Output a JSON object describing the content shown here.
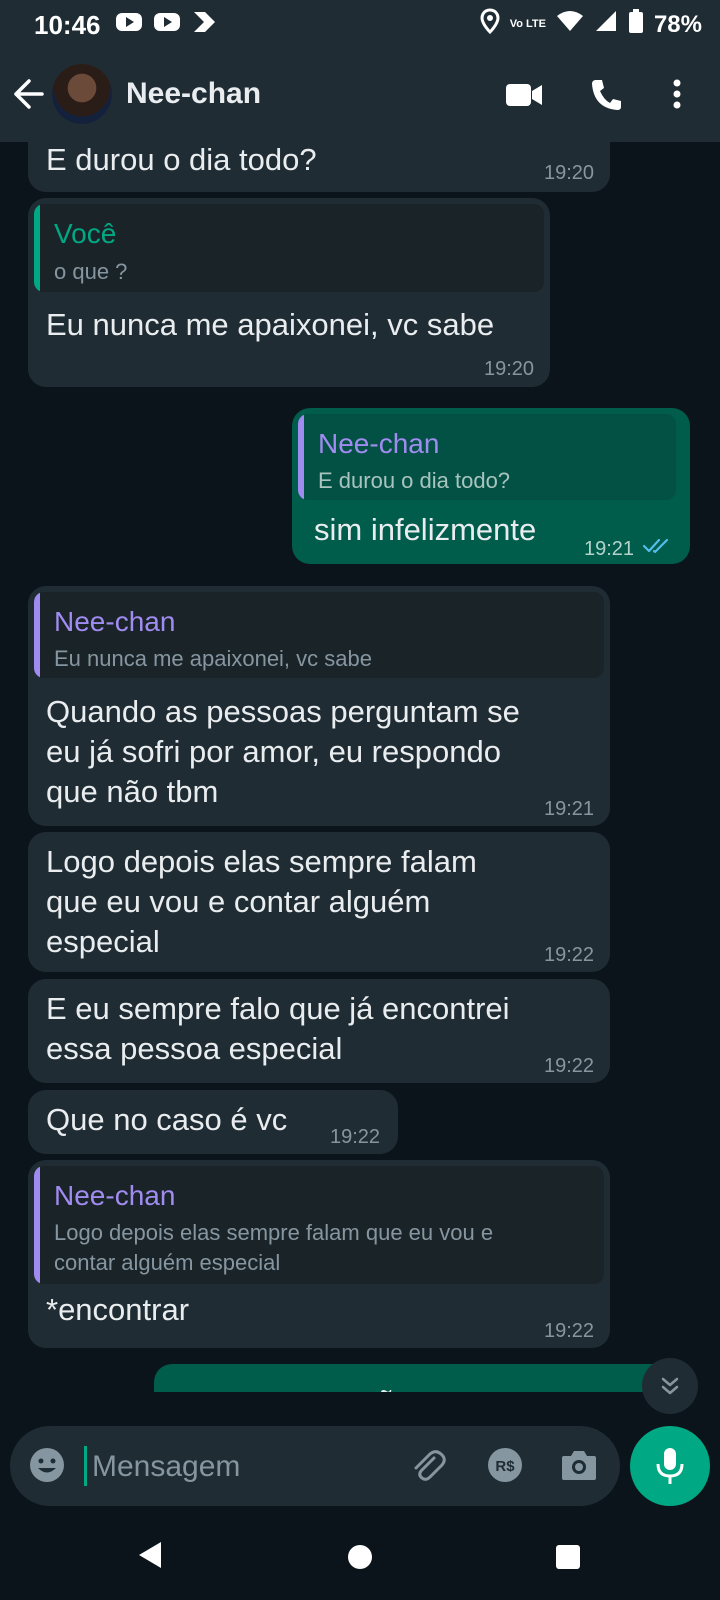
{
  "status_bar": {
    "time": "10:46",
    "network": "Vo LTE",
    "battery": "78%"
  },
  "header": {
    "contact_name": "Nee-chan"
  },
  "colors": {
    "outgoing": "#005c4b",
    "incoming": "#202c33",
    "accent": "#00a884",
    "quote_self": "#00a884",
    "quote_contact": "#a08cf0"
  },
  "messages": [
    {
      "direction": "in",
      "text": "E durou o dia todo?",
      "time": "19:20"
    },
    {
      "direction": "in",
      "quote": {
        "name": "Você",
        "text": "o que ?"
      },
      "text": "Eu nunca me apaixonei, vc sabe",
      "time": "19:20"
    },
    {
      "direction": "out",
      "quote": {
        "name": "Nee-chan",
        "text": "E durou o dia todo?"
      },
      "text": "sim infelizmente",
      "time": "19:21",
      "status": "read"
    },
    {
      "direction": "in",
      "quote": {
        "name": "Nee-chan",
        "text": "Eu nunca me apaixonei, vc sabe"
      },
      "text": "Quando as pessoas perguntam se\neu já sofri por amor, eu respondo\nque não tbm",
      "time": "19:21"
    },
    {
      "direction": "in",
      "text": "Logo depois elas sempre falam\nque eu vou e contar alguém\nespecial",
      "time": "19:22"
    },
    {
      "direction": "in",
      "text": "E eu sempre falo que já encontrei\nessa pessoa especial",
      "time": "19:22"
    },
    {
      "direction": "in",
      "text": "Que no caso é vc",
      "time": "19:22"
    },
    {
      "direction": "in",
      "quote": {
        "name": "Nee-chan",
        "text": "Logo depois elas sempre falam que eu vou e\ncontar alguém especial"
      },
      "text": "*encontrar",
      "time": "19:22"
    },
    {
      "direction": "out",
      "text": "por acaso eu não esperava"
    }
  ],
  "composer": {
    "placeholder": "Mensagem"
  }
}
